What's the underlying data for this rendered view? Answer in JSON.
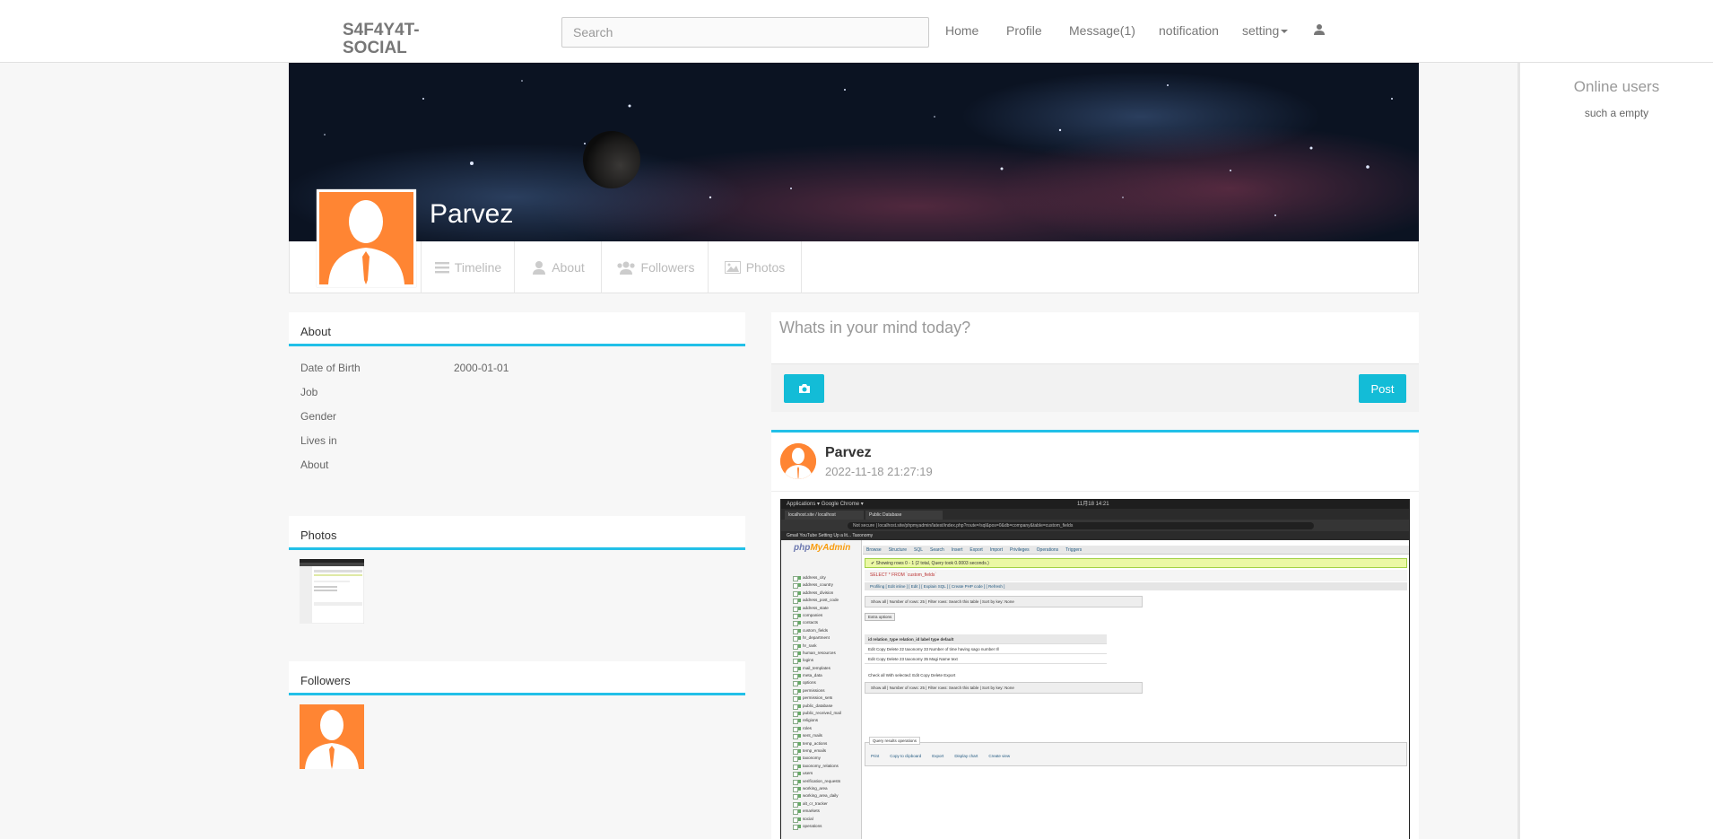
{
  "navbar": {
    "brand": "S4F4Y4T-SOCIAL",
    "search_placeholder": "Search",
    "items": [
      "Home",
      "Profile",
      "Message(1)",
      "notification",
      "setting"
    ]
  },
  "online": {
    "title": "Online users",
    "empty": "such a empty"
  },
  "profile": {
    "name": "Parvez",
    "tabs": [
      "Timeline",
      "About",
      "Followers",
      "Photos"
    ]
  },
  "about": {
    "title": "About",
    "rows": [
      {
        "label": "Date of Birth",
        "value": "2000-01-01"
      },
      {
        "label": "Job",
        "value": ""
      },
      {
        "label": "Gender",
        "value": ""
      },
      {
        "label": "Lives in",
        "value": ""
      },
      {
        "label": "About",
        "value": ""
      }
    ]
  },
  "photos": {
    "title": "Photos"
  },
  "followers": {
    "title": "Followers"
  },
  "postbox": {
    "placeholder": "Whats in your mind today?",
    "post_label": "Post"
  },
  "feed": {
    "author": "Parvez",
    "timestamp": "2022-11-18 21:27:19",
    "screenshot": {
      "topbar": "Applications ▾   Google Chrome ▾",
      "clock": "11月18 14:21",
      "tab1": "localhost.site / localhost",
      "tab2": "Public Database",
      "url": "Not secure  |  localhost.site/phpmyadmin/latest/index.php?route=/sql&pos=0&db=company&table=custom_fields",
      "bookmarks": "Gmail    YouTube    Setting Up a lit...    Taxonomy",
      "logo_a": "php",
      "logo_b": "MyAdmin",
      "tabs": [
        "Browse",
        "Structure",
        "SQL",
        "Search",
        "Insert",
        "Export",
        "Import",
        "Privileges",
        "Operations",
        "Triggers"
      ],
      "success": "✔ Showing rows 0 - 1 (2 total, Query took 0.0003 seconds.)",
      "sql": "SELECT * FROM `custom_fields`",
      "profiling": "Profiling [ Edit inline ] [ Edit ] [ Explain SQL ] [ Create PHP code ] [ Refresh ]",
      "nav_row": "Show all  |  Number of rows: 25  |  Filter rows: Search this table  |  Sort by key: None",
      "extra_options": "Extra options",
      "table_header": "id   relation_type   relation_id   label   type   default",
      "row1": "Edit  Copy  Delete   22  taxonomy   33  Number of time having sago  number  Ill",
      "row2": "Edit  Copy  Delete   23  taxonomy   35  Magi Name  text",
      "check_all": "Check all   With selected:   Edit   Copy   Delete   Export",
      "ops_title": "Query results operations",
      "ops_items": [
        "Print",
        "Copy to clipboard",
        "Export",
        "Display chart",
        "Create view"
      ],
      "tree": [
        "address_city",
        "address_country",
        "address_division",
        "address_post_code",
        "address_state",
        "companies",
        "contacts",
        "custom_fields",
        "hr_department",
        "hr_rank",
        "human_resources",
        "logins",
        "mail_templates",
        "meta_data",
        "options",
        "permissions",
        "permission_sets",
        "public_database",
        "public_received_mail",
        "religions",
        "roles",
        "sent_mails",
        "temp_actions",
        "temp_emails",
        "taxonomy",
        "taxonomy_relations",
        "users",
        "verification_requests",
        "working_area",
        "working_area_daily",
        "alt_cr_tracker",
        "emarkets",
        "social",
        "operations"
      ]
    }
  },
  "colors": {
    "accent": "#22c0e8",
    "button": "#13bcd7",
    "avatar_orange": "#ff8533"
  }
}
